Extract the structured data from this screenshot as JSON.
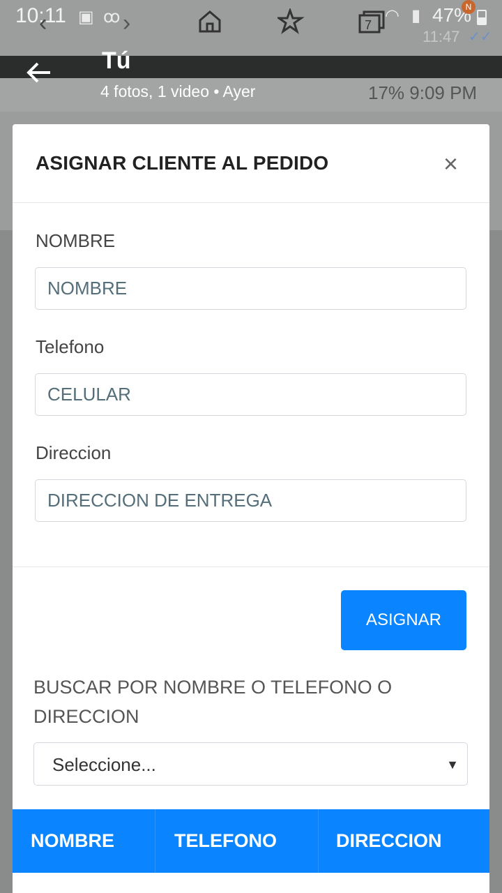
{
  "status_bar": {
    "time": "10:11",
    "battery": "47%",
    "notification_badge": "N",
    "ghost_time": "11:47",
    "icons": [
      "image-icon",
      "voicemail-icon",
      "back-chevron-icon",
      "home-icon",
      "star-icon",
      "tabs-icon",
      "wifi-icon",
      "signal-icon",
      "battery-icon"
    ],
    "tab_count": "7"
  },
  "chat_header": {
    "title": "Tú",
    "subtitle": "4 fotos, 1 video  •  Ayer",
    "status_text": "17%  9:09 PM"
  },
  "modal": {
    "title": "ASIGNAR CLIENTE AL PEDIDO",
    "close_glyph": "×",
    "fields": [
      {
        "label": "NOMBRE",
        "placeholder": "NOMBRE"
      },
      {
        "label": "Telefono",
        "placeholder": "CELULAR"
      },
      {
        "label": "Direccion",
        "placeholder": "DIRECCION DE ENTREGA"
      }
    ],
    "assign_button": "ASIGNAR",
    "search_label": "BUSCAR POR NOMBRE O TELEFONO O DIRECCION",
    "select_value": "Seleccione...",
    "table_headers": [
      "NOMBRE",
      "TELEFONO",
      "DIRECCION"
    ]
  },
  "colors": {
    "accent": "#0a84ff",
    "overlay": "#8a8c8c",
    "text": "#444444"
  }
}
